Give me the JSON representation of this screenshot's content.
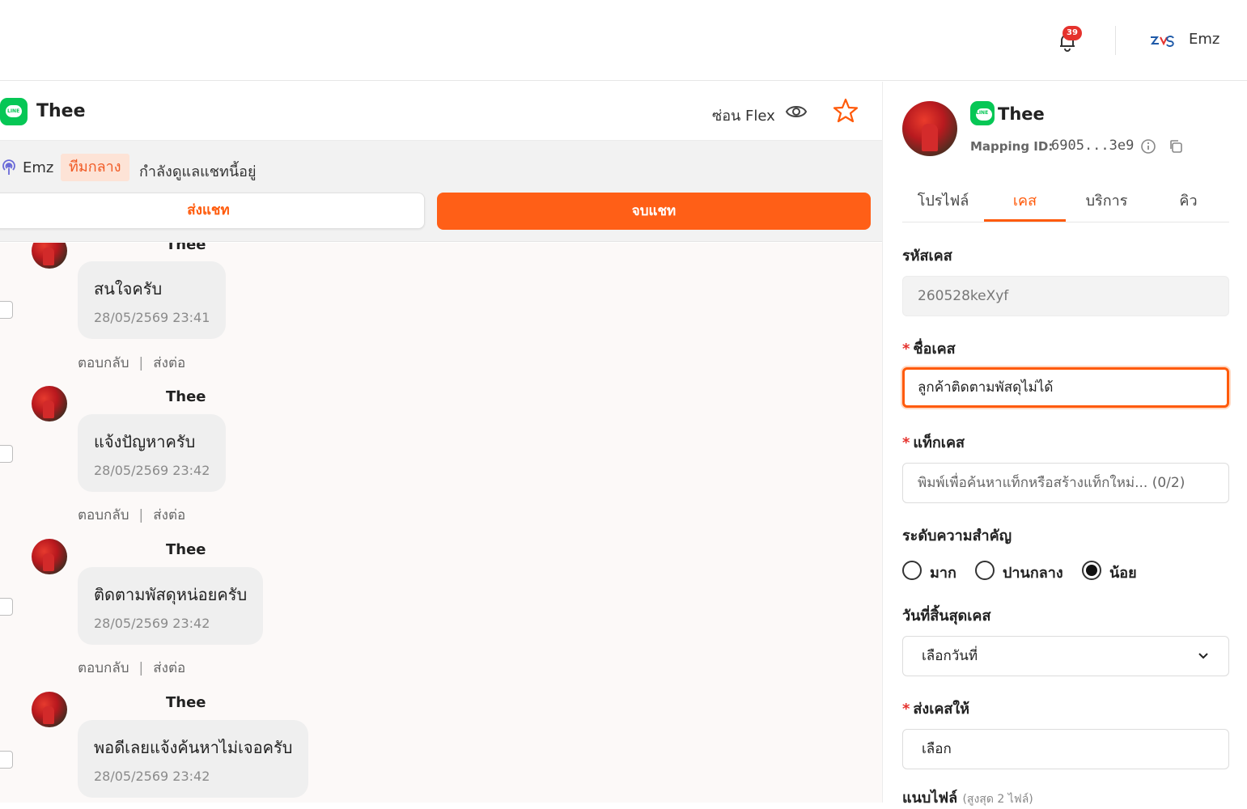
{
  "topbar": {
    "notification_count": "39",
    "user_name": "Emz"
  },
  "chat": {
    "title": "Thee",
    "hide_flex_label": "ซ่อน Flex",
    "status": {
      "agent_name": "Emz",
      "team": "ทีมกลาง",
      "text": "กำลังดูแลแชทนี้อยู่"
    },
    "send_chat_label": "ส่งแชท",
    "end_chat_label": "จบแชท",
    "messages": [
      {
        "sender": "Thee",
        "text": "สนใจครับ",
        "time": "28/05/2569 23:41",
        "reply": "ตอบกลับ",
        "forward": "ส่งต่อ"
      },
      {
        "sender": "Thee",
        "text": "แจ้งปัญหาครับ",
        "time": "28/05/2569 23:42",
        "reply": "ตอบกลับ",
        "forward": "ส่งต่อ"
      },
      {
        "sender": "Thee",
        "text": "ติดตามพัสดุหน่อยครับ",
        "time": "28/05/2569 23:42",
        "reply": "ตอบกลับ",
        "forward": "ส่งต่อ"
      },
      {
        "sender": "Thee",
        "text": "พอดีเลยแจ้งค้นหาไม่เจอครับ",
        "time": "28/05/2569 23:42",
        "reply": "ตอบกลับ",
        "forward": "ส่งต่อ"
      }
    ]
  },
  "profile": {
    "name": "Thee",
    "mapping_label": "Mapping ID:",
    "mapping_value": "6905...3e9"
  },
  "tabs": [
    {
      "label": "โปรไฟล์",
      "active": false
    },
    {
      "label": "เคส",
      "active": true
    },
    {
      "label": "บริการ",
      "active": false
    },
    {
      "label": "คิว",
      "active": false
    }
  ],
  "case_form": {
    "case_id_label": "รหัสเคส",
    "case_id_value": "260528keXyf",
    "case_name_label": "ชื่อเคส",
    "case_name_value": "ลูกค้าติดตามพัสดุไม่ได้",
    "case_tag_label": "แท็กเคส",
    "case_tag_placeholder": "พิมพ์เพื่อค้นหาแท็กหรือสร้างแท็กใหม่... (0/2)",
    "priority_label": "ระดับความสำคัญ",
    "priority_options": [
      {
        "label": "มาก",
        "selected": false
      },
      {
        "label": "ปานกลาง",
        "selected": false
      },
      {
        "label": "น้อย",
        "selected": true
      }
    ],
    "due_date_label": "วันที่สิ้นสุดเคส",
    "due_date_value": "เลือกวันที่",
    "assign_label": "ส่งเคสให้",
    "assign_value": "เลือก",
    "attachment_label": "แนบไฟล์",
    "attachment_hint": "(สูงสุด 2 ไฟล์)"
  },
  "colors": {
    "accent": "#ff5a0a",
    "line_green": "#06c755",
    "badge_red": "#e5322d"
  }
}
